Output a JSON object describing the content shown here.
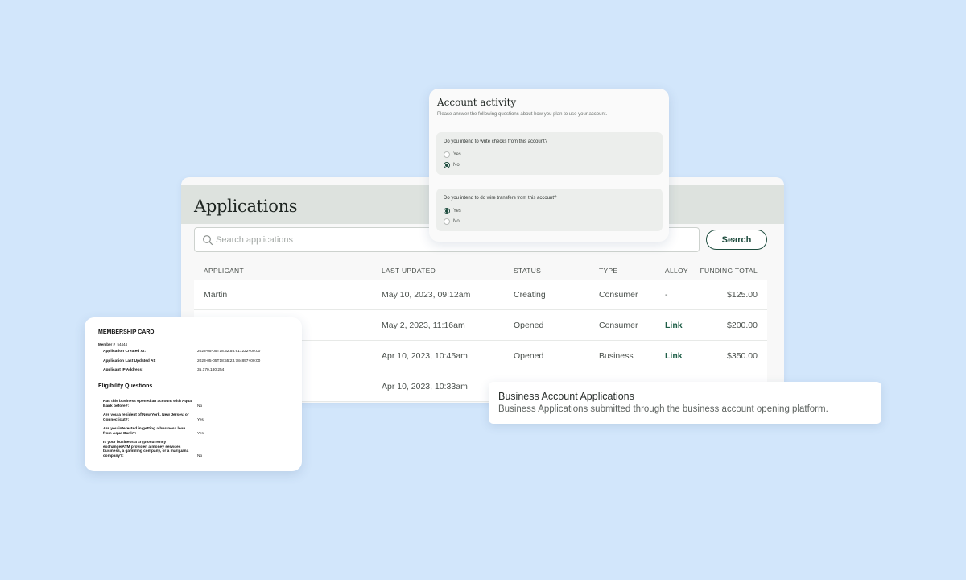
{
  "applications": {
    "title": "Applications",
    "search": {
      "placeholder": "Search applications",
      "value": "",
      "button_label": "Search"
    },
    "columns": [
      "APPLICANT",
      "LAST UPDATED",
      "STATUS",
      "TYPE",
      "ALLOY",
      "FUNDING TOTAL"
    ],
    "rows": [
      {
        "applicant": "Martin",
        "last_updated": "May 10, 2023, 09:12am",
        "status": "Creating",
        "type": "Consumer",
        "alloy": "-",
        "funding_total": "$125.00"
      },
      {
        "applicant": "",
        "last_updated": "May 2, 2023, 11:16am",
        "status": "Opened",
        "type": "Consumer",
        "alloy": "Link",
        "funding_total": "$200.00"
      },
      {
        "applicant": "",
        "last_updated": "Apr 10, 2023, 10:45am",
        "status": "Opened",
        "type": "Business",
        "alloy": "Link",
        "funding_total": "$350.00"
      },
      {
        "applicant": "",
        "last_updated": "Apr 10, 2023, 10:33am",
        "status": "",
        "type": "",
        "alloy": "",
        "funding_total": ""
      }
    ]
  },
  "account_activity": {
    "title": "Account activity",
    "subtitle": "Please answer the following questions about how you plan to use your account.",
    "questions": [
      {
        "text": "Do you intend to write checks from this account?",
        "options": [
          "Yes",
          "No"
        ],
        "selected": "No"
      },
      {
        "text": "Do you intend to do wire transfers from this account?",
        "options": [
          "Yes",
          "No"
        ],
        "selected": "Yes"
      }
    ]
  },
  "membership_card": {
    "title": "MEMBERSHIP CARD",
    "member_label": "Member #",
    "member_number": "54444",
    "details": [
      {
        "label": "Application Created At:",
        "value": "2023-05-05T18:52:55.917222+00:00"
      },
      {
        "label": "Application Last Updated At:",
        "value": "2023-05-05T18:55:23.784897+00:00"
      },
      {
        "label": "Applicant IP Address:",
        "value": "35.170.180.254"
      }
    ],
    "section_title": "Eligibility Questions",
    "eligibility": [
      {
        "question": "Has this business opened an account with Aqua Bank before?:",
        "answer": "No"
      },
      {
        "question": "Are you a resident of New York, New Jersey, or Connecticut?:",
        "answer": "Yes"
      },
      {
        "question": "Are you interested in getting a business loan from Aqua Bank?:",
        "answer": "Yes"
      },
      {
        "question": "Is your business a cryptocurrency exchange/ATM provider, a money services business, a gambling company, or a marijuana company?:",
        "answer": "No"
      }
    ]
  },
  "business_tooltip": {
    "title": "Business Account Applications",
    "subtitle": "Business Applications submitted through the business account opening platform."
  },
  "colors": {
    "background": "#d2e6fb",
    "accent": "#1f4d3f",
    "link": "#1f5f48",
    "header_band": "#dde2de"
  }
}
